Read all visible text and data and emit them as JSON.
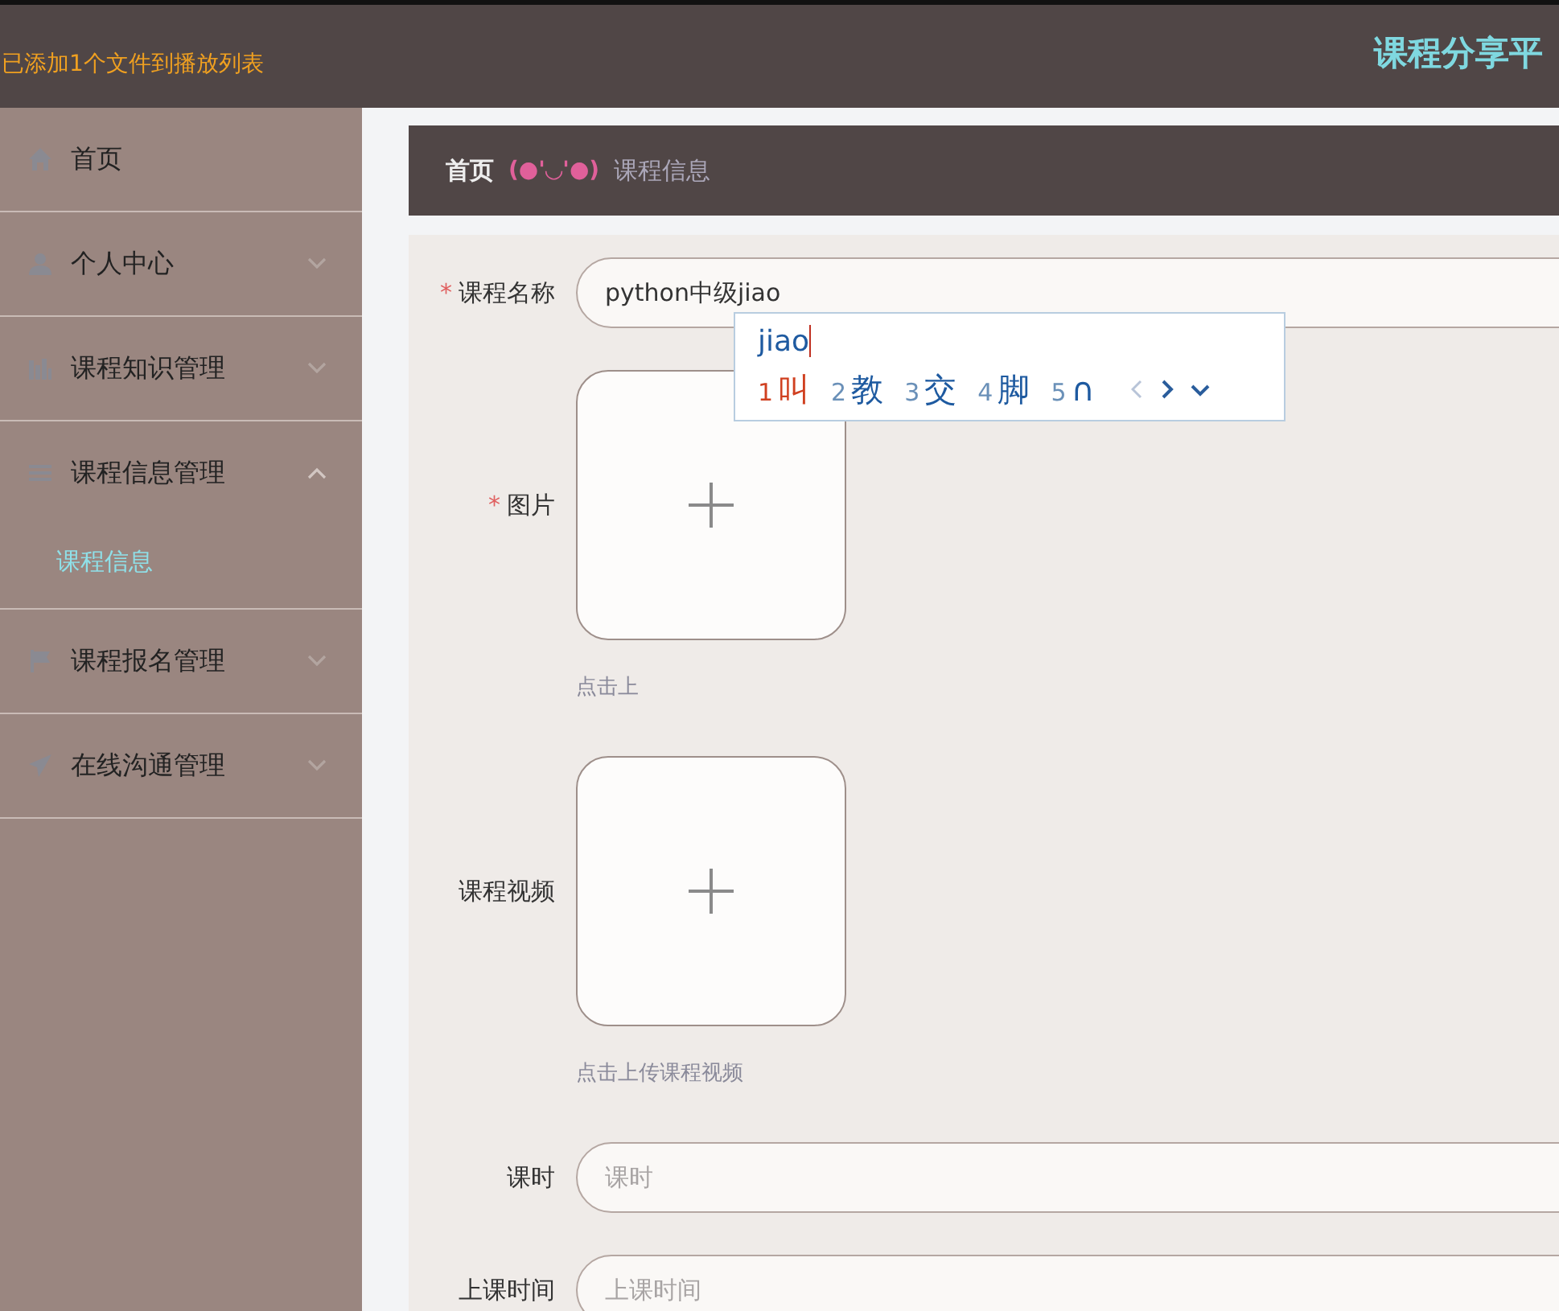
{
  "top_bar": {
    "notice": "已添加1个文件到播放列表",
    "site_title": "课程分享平"
  },
  "sidebar": {
    "items": [
      {
        "label": "首页"
      },
      {
        "label": "个人中心",
        "expanded": false
      },
      {
        "label": "课程知识管理",
        "expanded": false
      },
      {
        "label": "课程信息管理",
        "expanded": true,
        "children": [
          {
            "label": "课程信息",
            "selected": true
          }
        ]
      },
      {
        "label": "课程报名管理",
        "expanded": false
      },
      {
        "label": "在线沟通管理",
        "expanded": false
      }
    ]
  },
  "breadcrumb": {
    "home": "首页",
    "separator": "(●'◡'●)",
    "current": "课程信息"
  },
  "form": {
    "fields": [
      {
        "kind": "text",
        "label": "课程名称",
        "required_mark": "*",
        "value": "python中级jiao"
      },
      {
        "kind": "upload",
        "label": "图片",
        "required_mark": "*",
        "hint": "点击上"
      },
      {
        "kind": "upload",
        "label": "课程视频",
        "hint": "点击上传课程视频"
      },
      {
        "kind": "text",
        "label": "课时",
        "placeholder": "课时"
      },
      {
        "kind": "text",
        "label": "上课时间",
        "placeholder": "上课时间"
      }
    ]
  },
  "ime_popup": {
    "composition": "jiao",
    "candidates": [
      {
        "index": "1",
        "text": "叫",
        "selected": true
      },
      {
        "index": "2",
        "text": "教",
        "selected": false
      },
      {
        "index": "3",
        "text": "交",
        "selected": false
      },
      {
        "index": "4",
        "text": "脚",
        "selected": false
      },
      {
        "index": "5",
        "text": "∩",
        "selected": false
      }
    ]
  }
}
